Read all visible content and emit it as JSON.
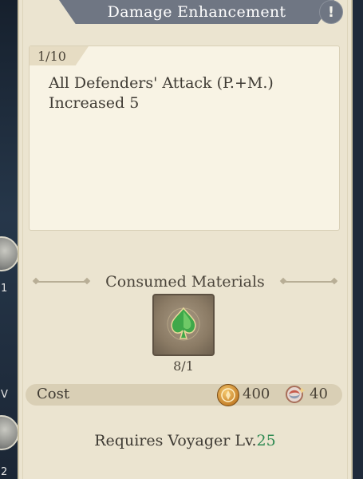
{
  "panel": {
    "title": "Damage Enhancement",
    "info_button_symbol": "!"
  },
  "description": {
    "level": "1/10",
    "text": "All Defenders' Attack (P.+M.) Increased 5"
  },
  "materials": {
    "heading": "Consumed Materials",
    "items": [
      {
        "icon": "green-spade-crystal-icon",
        "count": "8/1"
      }
    ]
  },
  "cost": {
    "label": "Cost",
    "gold": {
      "icon": "gold-coin-icon",
      "amount": "400"
    },
    "token": {
      "icon": "swirl-token-icon",
      "amount": "40"
    }
  },
  "requirement": {
    "prefix": "Requires Voyager Lv.",
    "level": "25"
  },
  "background_edge": {
    "badge_count_1": "1",
    "badge_letter": "V",
    "badge_count_2": "2"
  },
  "colors": {
    "panel_bg": "#ebe4d0",
    "title_bar": "#6f7683",
    "level_highlight": "#2f8a52"
  }
}
